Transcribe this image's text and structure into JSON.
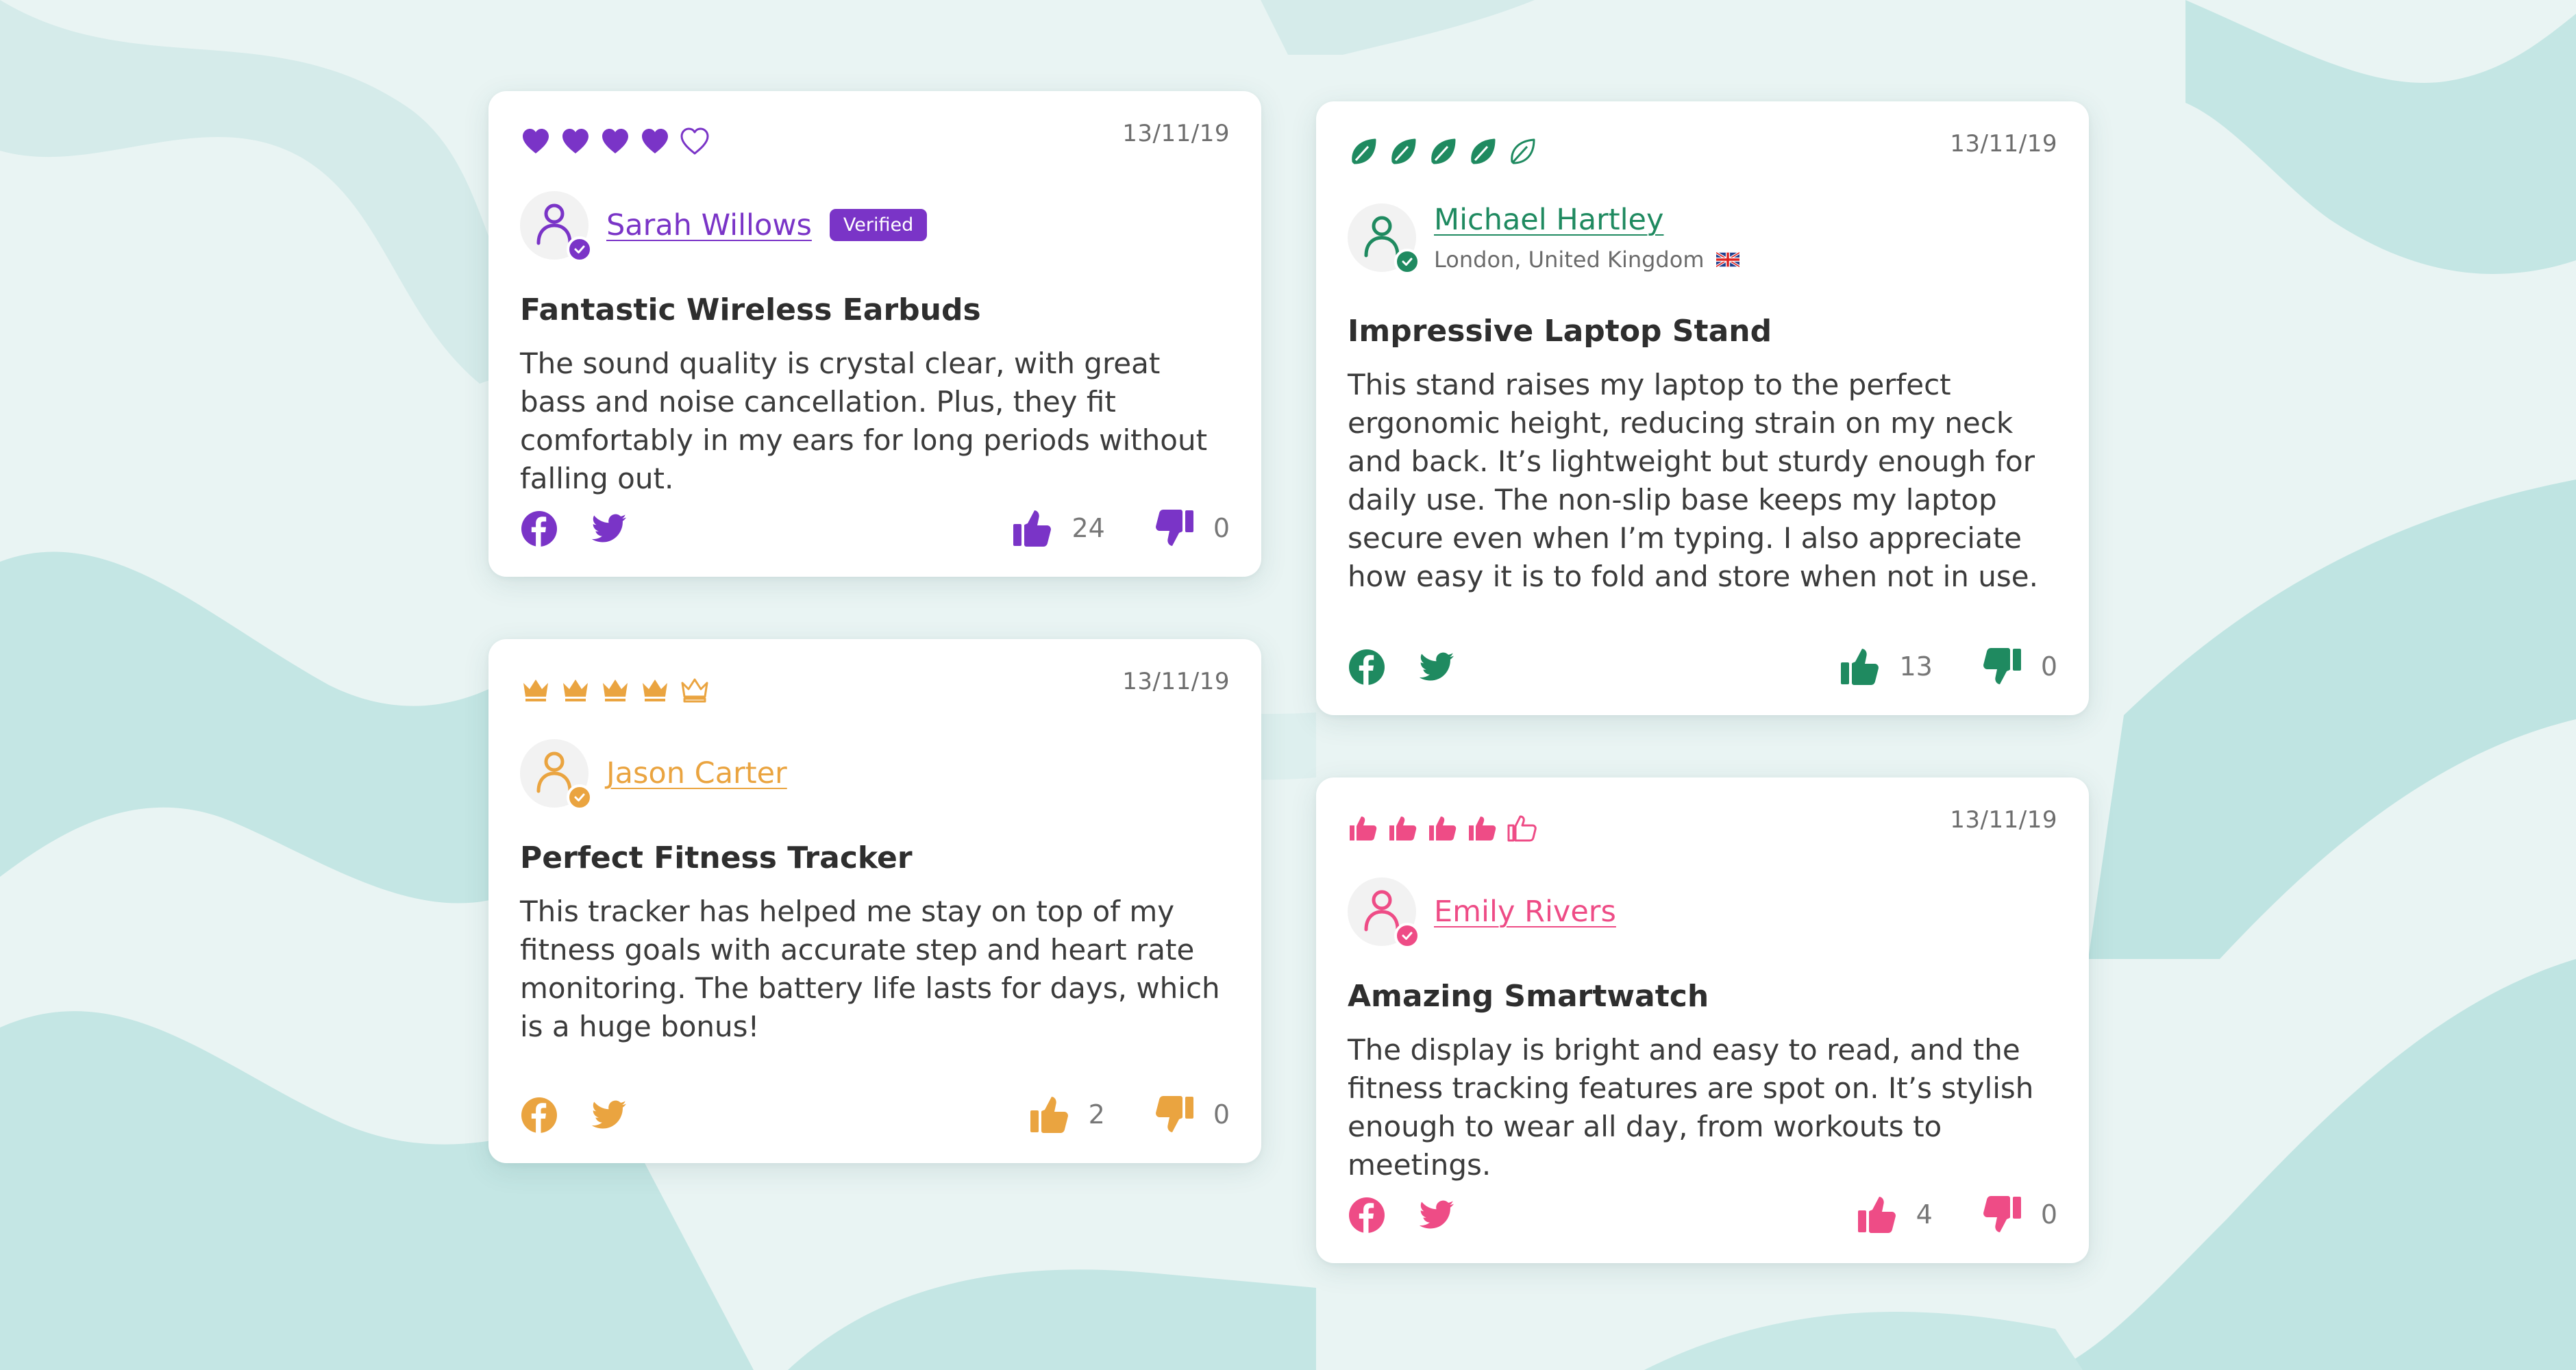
{
  "reviews": [
    {
      "theme": "#7a34c7",
      "rating_icon": "heart-icon",
      "rating": 4,
      "rating_max": 5,
      "date": "13/11/19",
      "author": "Sarah Willows",
      "badge": "Verified",
      "title": "Fantastic Wireless Earbuds",
      "body": "The sound quality is crystal clear, with great bass and noise cancellation. Plus, they fit comfortably in my ears for long periods without falling out.",
      "up_count": "24",
      "down_count": "0"
    },
    {
      "theme": "#eaa440",
      "rating_icon": "crown-icon",
      "rating": 4,
      "rating_max": 5,
      "date": "13/11/19",
      "author": "Jason Carter",
      "title": "Perfect Fitness Tracker",
      "body": "This tracker has helped me stay on top of my fitness goals with accurate step and heart rate monitoring. The battery life lasts for days, which is a huge bonus!",
      "up_count": "2",
      "down_count": "0"
    },
    {
      "theme": "#1f8a60",
      "rating_icon": "leaf-icon",
      "rating": 4,
      "rating_max": 5,
      "date": "13/11/19",
      "author": "Michael Hartley",
      "location": "London, United Kingdom",
      "flag": "uk-flag-icon",
      "title": "Impressive Laptop Stand",
      "body": "This stand raises my laptop to the perfect ergonomic height, reducing strain on my neck and back. It’s lightweight but sturdy enough for daily use. The non-slip base keeps my laptop secure even when I’m typing. I also appreciate how easy it is to fold and store when not in use.",
      "up_count": "13",
      "down_count": "0"
    },
    {
      "theme": "#ee4c86",
      "rating_icon": "thumbs-up-icon",
      "rating": 4,
      "rating_max": 5,
      "date": "13/11/19",
      "author": "Emily Rivers",
      "title": "Amazing Smartwatch",
      "body": "The display is bright and easy to read, and the fitness tracking features are spot on. It’s stylish enough to wear all day, from workouts to meetings.",
      "up_count": "4",
      "down_count": "0"
    }
  ]
}
